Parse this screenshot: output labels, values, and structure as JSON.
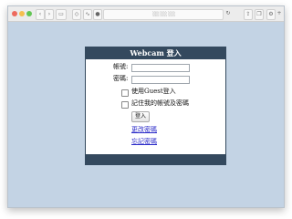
{
  "browser": {
    "address_text": " ░░ ░░ ░░"
  },
  "panel": {
    "title": "Webcam 登入",
    "account_label": "帳號:",
    "password_label": "密碼:",
    "guest_label": "使用Guest登入",
    "remember_label": "記住我的帳號及密碼",
    "login_button": "登入",
    "change_password_link": "更改密碼",
    "forgot_password_link": "忘記密碼"
  },
  "colors": {
    "panel_header": "#34495e",
    "window_bg": "#c3d3e4",
    "link": "#2a2ac8"
  }
}
